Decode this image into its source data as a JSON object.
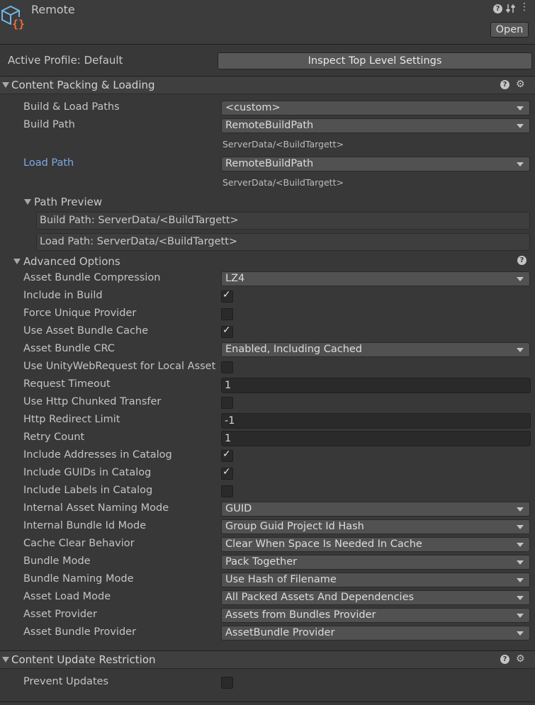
{
  "header": {
    "title": "Remote",
    "logo_icon": "package-braces-icon",
    "open_label": "Open"
  },
  "profile": {
    "label": "Active Profile: Default",
    "inspect_label": "Inspect Top Level Settings"
  },
  "content_packing": {
    "title": "Content Packing & Loading",
    "build_load_paths": {
      "label": "Build & Load Paths",
      "value": "<custom>"
    },
    "build_path": {
      "label": "Build Path",
      "value": "RemoteBuildPath",
      "resolved": "ServerData/<BuildTargett>"
    },
    "load_path": {
      "label": "Load Path",
      "value": "RemoteBuildPath",
      "resolved": "ServerData/<BuildTargett>"
    },
    "path_preview": {
      "label": "Path Preview",
      "build": "Build Path: ServerData/<BuildTargett>",
      "load": "Load Path: ServerData/<BuildTargett>"
    },
    "advanced": {
      "label": "Advanced Options",
      "asset_bundle_compression": {
        "label": "Asset Bundle Compression",
        "value": "LZ4"
      },
      "include_in_build": {
        "label": "Include in Build",
        "checked": true
      },
      "force_unique_provider": {
        "label": "Force Unique Provider",
        "checked": false
      },
      "use_asset_bundle_cache": {
        "label": "Use Asset Bundle Cache",
        "checked": true
      },
      "asset_bundle_crc": {
        "label": "Asset Bundle CRC",
        "value": "Enabled, Including Cached"
      },
      "use_uwr_local": {
        "label": "Use UnityWebRequest for Local Asset",
        "checked": false
      },
      "request_timeout": {
        "label": "Request Timeout",
        "value": "1"
      },
      "use_http_chunked": {
        "label": "Use Http Chunked Transfer",
        "checked": false
      },
      "http_redirect_limit": {
        "label": "Http Redirect Limit",
        "value": "-1"
      },
      "retry_count": {
        "label": "Retry Count",
        "value": "1"
      },
      "include_addresses": {
        "label": "Include Addresses in Catalog",
        "checked": true
      },
      "include_guids": {
        "label": "Include GUIDs in Catalog",
        "checked": true
      },
      "include_labels": {
        "label": "Include Labels in Catalog",
        "checked": false
      },
      "internal_asset_naming": {
        "label": "Internal Asset Naming Mode",
        "value": "GUID"
      },
      "internal_bundle_id": {
        "label": "Internal Bundle Id Mode",
        "value": "Group Guid Project Id Hash"
      },
      "cache_clear": {
        "label": "Cache Clear Behavior",
        "value": "Clear When Space Is Needed In Cache"
      },
      "bundle_mode": {
        "label": "Bundle Mode",
        "value": "Pack Together"
      },
      "bundle_naming": {
        "label": "Bundle Naming Mode",
        "value": "Use Hash of Filename"
      },
      "asset_load_mode": {
        "label": "Asset Load Mode",
        "value": "All Packed Assets And Dependencies"
      },
      "asset_provider": {
        "label": "Asset Provider",
        "value": "Assets from Bundles Provider"
      },
      "asset_bundle_provider": {
        "label": "Asset Bundle Provider",
        "value": "AssetBundle Provider"
      }
    }
  },
  "content_update": {
    "title": "Content Update Restriction",
    "prevent_updates": {
      "label": "Prevent Updates",
      "checked": false
    }
  },
  "icons": {
    "help": "?",
    "check": "✓"
  }
}
